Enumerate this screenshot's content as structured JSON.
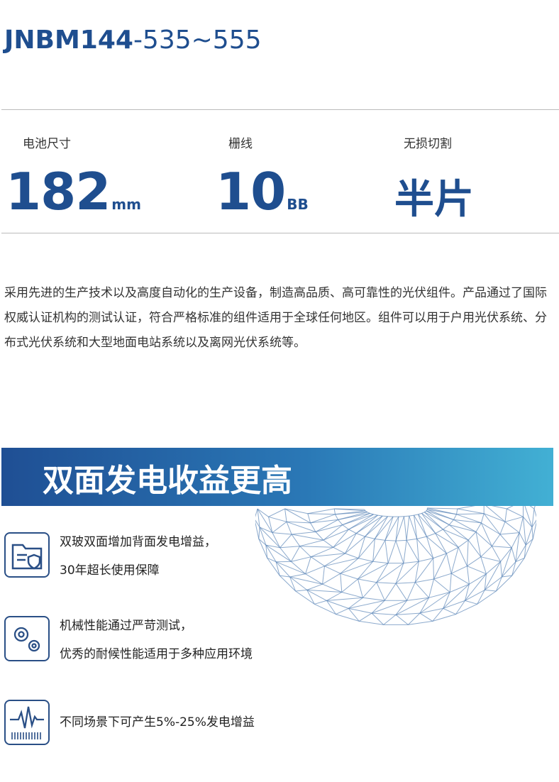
{
  "header": {
    "model_bold": "JNBM144",
    "model_rest": "-535~555"
  },
  "specs": [
    {
      "label": "电池尺寸",
      "value": "182",
      "unit": "mm"
    },
    {
      "label": "栅线",
      "value": "10",
      "unit": "BB"
    },
    {
      "label": "无损切割",
      "value": "半片",
      "unit": ""
    }
  ],
  "description": "采用先进的生产技术以及高度自动化的生产设备，制造高品质、高可靠性的光伏组件。产品通过了国际权威认证机构的测试认证，符合严格标准的组件适用于全球任何地区。组件可以用于户用光伏系统、分布式光伏系统和大型地面电站系统以及离网光伏系统等。",
  "banner": {
    "title": "双面发电收益更高"
  },
  "features": [
    {
      "icon": "folder-shield-icon",
      "line1": "双玻双面增加背面发电增益，",
      "line2": "30年超长使用保障"
    },
    {
      "icon": "gears-icon",
      "line1": "机械性能通过严苛测试，",
      "line2": "优秀的耐候性能适用于多种应用环境"
    },
    {
      "icon": "waveform-icon",
      "line1": "不同场景下可产生5%-25%发电增益",
      "line2": ""
    }
  ],
  "colors": {
    "brand": "#1f4e8f",
    "banner_start": "#1f4f94",
    "banner_end": "#42b0d4",
    "divider": "#bbbbbb"
  }
}
